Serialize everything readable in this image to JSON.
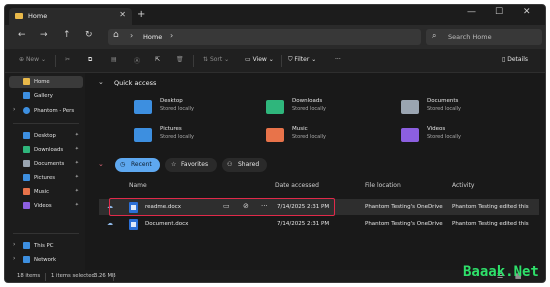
{
  "window": {
    "tab_title": "Home",
    "tab_close": "✕",
    "new_tab": "+",
    "minimize": "—",
    "maximize": "☐",
    "close": "✕"
  },
  "nav": {
    "back": "←",
    "forward": "→",
    "up": "↑",
    "refresh": "↻",
    "address_chevron": "›",
    "address_text": "Home",
    "address_chevron_2": "›",
    "search_icon": "⌕",
    "search_placeholder": "Search Home"
  },
  "toolbar": {
    "new": "New",
    "sort": "Sort",
    "view": "View",
    "filter": "Filter",
    "more": "···",
    "details": "Details"
  },
  "sidebar": {
    "items": [
      {
        "label": "Home",
        "icon": "home-icon",
        "color": "#e9b94a",
        "chevron": "",
        "pin": ""
      },
      {
        "label": "Gallery",
        "icon": "gallery-icon",
        "color": "#3d8fe0",
        "chevron": "",
        "pin": ""
      },
      {
        "label": "Phantom - Pers",
        "icon": "onedrive-icon",
        "color": "#3d8fe0",
        "chevron": "›",
        "pin": ""
      },
      {
        "label": "Desktop",
        "icon": "desktop-icon",
        "color": "#3d8fe0",
        "chevron": "",
        "pin": "✦"
      },
      {
        "label": "Downloads",
        "icon": "downloads-icon",
        "color": "#2fb67c",
        "chevron": "",
        "pin": "✦"
      },
      {
        "label": "Documents",
        "icon": "documents-icon",
        "color": "#9aa5b1",
        "chevron": "",
        "pin": "✦"
      },
      {
        "label": "Pictures",
        "icon": "pictures-icon",
        "color": "#3d8fe0",
        "chevron": "",
        "pin": "✦"
      },
      {
        "label": "Music",
        "icon": "music-icon",
        "color": "#e8734a",
        "chevron": "",
        "pin": "✦"
      },
      {
        "label": "Videos",
        "icon": "videos-icon",
        "color": "#8c5fe0",
        "chevron": "",
        "pin": "✦"
      },
      {
        "label": "This PC",
        "icon": "pc-icon",
        "color": "#3d8fe0",
        "chevron": "›",
        "pin": ""
      },
      {
        "label": "Network",
        "icon": "network-icon",
        "color": "#3d8fe0",
        "chevron": "›",
        "pin": ""
      }
    ]
  },
  "quick_access": {
    "chevron": "⌄",
    "title": "Quick access",
    "items": [
      {
        "name": "Desktop",
        "sub": "Stored locally",
        "color": "#3d8fe0"
      },
      {
        "name": "Downloads",
        "sub": "Stored locally",
        "color": "#2fb67c"
      },
      {
        "name": "Documents",
        "sub": "Stored locally",
        "color": "#9aa5b1"
      },
      {
        "name": "Pictures",
        "sub": "Stored locally",
        "color": "#3d8fe0"
      },
      {
        "name": "Music",
        "sub": "Stored locally",
        "color": "#e8734a"
      },
      {
        "name": "Videos",
        "sub": "Stored locally",
        "color": "#8c5fe0"
      }
    ]
  },
  "tabs": {
    "chevron": "⌄",
    "recent": "Recent",
    "favorites": "Favorites",
    "shared": "Shared"
  },
  "files": {
    "columns": [
      "Name",
      "Date accessed",
      "File location",
      "Activity"
    ],
    "rows": [
      {
        "name": "readme.docx",
        "date": "7/14/2025 2:31 PM",
        "location": "Phantom Testing's OneDrive",
        "activity": "Phantom Testing edited this"
      },
      {
        "name": "Document.docx",
        "date": "7/14/2025 2:31 PM",
        "location": "Phantom Testing's OneDrive",
        "activity": "Phantom Testing edited this"
      }
    ],
    "row_actions": {
      "open_location": "▭",
      "share": "⊘",
      "more": "···"
    }
  },
  "status": {
    "items_count": "18 items",
    "selected": "1 items selected",
    "size": "3.26 MB",
    "details_view_icon": "☰",
    "tiles_view_icon": "▦"
  },
  "watermark": "Baaak.Net",
  "colors": {
    "accent": "#5ea8f0",
    "highlight": "#e02a4a"
  }
}
